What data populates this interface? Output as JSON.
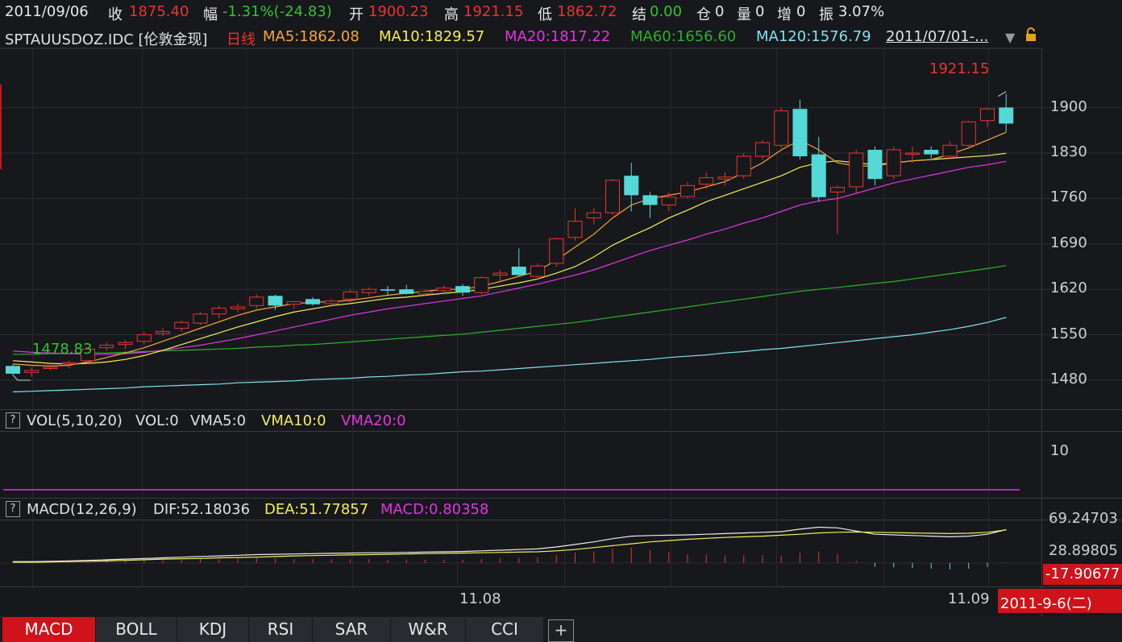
{
  "header": {
    "date": "2011/09/06",
    "close_label": "收",
    "close_value": "1875.40",
    "change_label": "幅",
    "change_value": "-1.31%(-24.83)",
    "open_label": "开",
    "open_value": "1900.23",
    "high_label": "高",
    "high_value": "1921.15",
    "low_label": "低",
    "low_value": "1862.72",
    "settle_label": "结",
    "settle_value": "0.00",
    "position_label": "仓",
    "position_value": "0",
    "volume_label": "量",
    "volume_value": "0",
    "increase_label": "增",
    "increase_value": "0",
    "amplitude_label": "振",
    "amplitude_value": "3.07%"
  },
  "main_panel": {
    "symbol": "SPTAUUSDOZ.IDC [伦敦金现]",
    "period": "日线",
    "ma5": "MA5:1862.08",
    "ma10": "MA10:1829.57",
    "ma20": "MA20:1817.22",
    "ma60": "MA60:1656.60",
    "ma120": "MA120:1576.79",
    "range": "2011/07/01-...",
    "high_marker": "1921.15",
    "low_marker": "1478.83",
    "y_ticks": [
      "1900",
      "1830",
      "1760",
      "1690",
      "1620",
      "1550",
      "1480"
    ]
  },
  "vol_panel": {
    "q": "?",
    "name": "VOL(5,10,20)",
    "vol": "VOL:0",
    "vma5": "VMA5:0",
    "vma10": "VMA10:0",
    "vma20": "VMA20:0",
    "y_tick": "10"
  },
  "macd_panel": {
    "q": "?",
    "name": "MACD(12,26,9)",
    "dif": "DIF:52.18036",
    "dea": "DEA:51.77857",
    "macd": "MACD:0.80358",
    "y_ticks": [
      "69.24703",
      "28.89805",
      "-17.90677"
    ]
  },
  "x_axis": {
    "labels": [
      "11.08",
      "11.09"
    ],
    "current_date": "2011-9-6(二)"
  },
  "tabs": [
    "MACD",
    "BOLL",
    "KDJ",
    "RSI",
    "SAR",
    "W&R",
    "CCI",
    "+"
  ],
  "colors": {
    "up": "#e8352f",
    "down": "#54d8d8",
    "ma5": "#f6a53a",
    "ma10": "#f2ef57",
    "ma20": "#e035e0",
    "ma60": "#2ab12a",
    "ma120": "#7de3ee"
  },
  "chart_data": {
    "type": "candlestick",
    "price_range": [
      1450,
      1930
    ],
    "candles": [
      {
        "o": 1502,
        "h": 1505,
        "l": 1488,
        "c": 1490
      },
      {
        "o": 1492,
        "h": 1500,
        "l": 1485,
        "c": 1495
      },
      {
        "o": 1498,
        "h": 1505,
        "l": 1495,
        "c": 1500
      },
      {
        "o": 1505,
        "h": 1510,
        "l": 1498,
        "c": 1507
      },
      {
        "o": 1510,
        "h": 1530,
        "l": 1505,
        "c": 1528
      },
      {
        "o": 1530,
        "h": 1538,
        "l": 1525,
        "c": 1534
      },
      {
        "o": 1535,
        "h": 1542,
        "l": 1528,
        "c": 1538
      },
      {
        "o": 1540,
        "h": 1555,
        "l": 1535,
        "c": 1550
      },
      {
        "o": 1552,
        "h": 1560,
        "l": 1548,
        "c": 1555
      },
      {
        "o": 1560,
        "h": 1572,
        "l": 1555,
        "c": 1569
      },
      {
        "o": 1568,
        "h": 1585,
        "l": 1565,
        "c": 1582
      },
      {
        "o": 1582,
        "h": 1595,
        "l": 1575,
        "c": 1591
      },
      {
        "o": 1590,
        "h": 1598,
        "l": 1585,
        "c": 1593
      },
      {
        "o": 1595,
        "h": 1612,
        "l": 1590,
        "c": 1608
      },
      {
        "o": 1610,
        "h": 1612,
        "l": 1588,
        "c": 1595
      },
      {
        "o": 1597,
        "h": 1602,
        "l": 1590,
        "c": 1601
      },
      {
        "o": 1605,
        "h": 1608,
        "l": 1595,
        "c": 1597
      },
      {
        "o": 1598,
        "h": 1605,
        "l": 1596,
        "c": 1602
      },
      {
        "o": 1605,
        "h": 1620,
        "l": 1600,
        "c": 1616
      },
      {
        "o": 1615,
        "h": 1623,
        "l": 1610,
        "c": 1620
      },
      {
        "o": 1620,
        "h": 1625,
        "l": 1610,
        "c": 1618
      },
      {
        "o": 1620,
        "h": 1627,
        "l": 1612,
        "c": 1613
      },
      {
        "o": 1613,
        "h": 1620,
        "l": 1610,
        "c": 1617
      },
      {
        "o": 1618,
        "h": 1626,
        "l": 1612,
        "c": 1622
      },
      {
        "o": 1625,
        "h": 1628,
        "l": 1610,
        "c": 1615
      },
      {
        "o": 1615,
        "h": 1640,
        "l": 1612,
        "c": 1638
      },
      {
        "o": 1642,
        "h": 1650,
        "l": 1632,
        "c": 1645
      },
      {
        "o": 1655,
        "h": 1683,
        "l": 1640,
        "c": 1642
      },
      {
        "o": 1640,
        "h": 1660,
        "l": 1635,
        "c": 1656
      },
      {
        "o": 1660,
        "h": 1700,
        "l": 1655,
        "c": 1698
      },
      {
        "o": 1700,
        "h": 1745,
        "l": 1695,
        "c": 1725
      },
      {
        "o": 1730,
        "h": 1745,
        "l": 1720,
        "c": 1738
      },
      {
        "o": 1738,
        "h": 1790,
        "l": 1735,
        "c": 1788
      },
      {
        "o": 1795,
        "h": 1815,
        "l": 1740,
        "c": 1765
      },
      {
        "o": 1765,
        "h": 1770,
        "l": 1730,
        "c": 1750
      },
      {
        "o": 1750,
        "h": 1770,
        "l": 1740,
        "c": 1762
      },
      {
        "o": 1763,
        "h": 1785,
        "l": 1760,
        "c": 1780
      },
      {
        "o": 1782,
        "h": 1800,
        "l": 1775,
        "c": 1792
      },
      {
        "o": 1790,
        "h": 1800,
        "l": 1780,
        "c": 1793
      },
      {
        "o": 1795,
        "h": 1830,
        "l": 1790,
        "c": 1825
      },
      {
        "o": 1825,
        "h": 1850,
        "l": 1820,
        "c": 1846
      },
      {
        "o": 1842,
        "h": 1900,
        "l": 1838,
        "c": 1895
      },
      {
        "o": 1898,
        "h": 1912,
        "l": 1820,
        "c": 1825
      },
      {
        "o": 1828,
        "h": 1855,
        "l": 1755,
        "c": 1762
      },
      {
        "o": 1770,
        "h": 1780,
        "l": 1705,
        "c": 1777
      },
      {
        "o": 1778,
        "h": 1835,
        "l": 1768,
        "c": 1830
      },
      {
        "o": 1835,
        "h": 1840,
        "l": 1780,
        "c": 1790
      },
      {
        "o": 1795,
        "h": 1840,
        "l": 1790,
        "c": 1835
      },
      {
        "o": 1830,
        "h": 1840,
        "l": 1815,
        "c": 1830
      },
      {
        "o": 1835,
        "h": 1840,
        "l": 1822,
        "c": 1828
      },
      {
        "o": 1825,
        "h": 1848,
        "l": 1820,
        "c": 1842
      },
      {
        "o": 1842,
        "h": 1880,
        "l": 1838,
        "c": 1878
      },
      {
        "o": 1880,
        "h": 1900,
        "l": 1870,
        "c": 1898
      },
      {
        "o": 1900.23,
        "h": 1921.15,
        "l": 1862.72,
        "c": 1875.4
      }
    ],
    "ma5": [
      1505,
      1503,
      1502,
      1503,
      1508,
      1515,
      1522,
      1530,
      1540,
      1550,
      1560,
      1570,
      1580,
      1588,
      1593,
      1598,
      1600,
      1601,
      1603,
      1607,
      1611,
      1614,
      1617,
      1620,
      1620,
      1625,
      1632,
      1640,
      1648,
      1665,
      1685,
      1705,
      1730,
      1750,
      1760,
      1765,
      1770,
      1778,
      1786,
      1800,
      1815,
      1835,
      1850,
      1835,
      1815,
      1810,
      1810,
      1815,
      1818,
      1820,
      1828,
      1838,
      1850,
      1862.08
    ],
    "ma10": [
      1510,
      1508,
      1506,
      1505,
      1506,
      1508,
      1512,
      1518,
      1526,
      1535,
      1544,
      1553,
      1562,
      1570,
      1578,
      1585,
      1590,
      1595,
      1598,
      1602,
      1606,
      1608,
      1611,
      1614,
      1616,
      1620,
      1625,
      1630,
      1636,
      1645,
      1655,
      1670,
      1688,
      1702,
      1715,
      1730,
      1742,
      1755,
      1765,
      1775,
      1785,
      1795,
      1808,
      1815,
      1818,
      1815,
      1812,
      1815,
      1818,
      1820,
      1822,
      1824,
      1826,
      1829.57
    ],
    "ma20": [
      1525,
      1523,
      1522,
      1521,
      1520,
      1520,
      1521,
      1523,
      1526,
      1530,
      1534,
      1539,
      1544,
      1550,
      1556,
      1562,
      1568,
      1574,
      1580,
      1585,
      1590,
      1594,
      1598,
      1602,
      1606,
      1610,
      1616,
      1622,
      1628,
      1635,
      1642,
      1650,
      1660,
      1670,
      1680,
      1688,
      1696,
      1705,
      1713,
      1722,
      1730,
      1740,
      1750,
      1756,
      1760,
      1768,
      1776,
      1784,
      1790,
      1796,
      1802,
      1808,
      1812,
      1817.22
    ],
    "ma60": [
      1520,
      1520,
      1521,
      1521,
      1522,
      1522,
      1523,
      1524,
      1525,
      1526,
      1527,
      1528,
      1529,
      1531,
      1532,
      1534,
      1535,
      1537,
      1539,
      1541,
      1543,
      1545,
      1547,
      1549,
      1551,
      1554,
      1557,
      1560,
      1563,
      1566,
      1569,
      1573,
      1577,
      1581,
      1585,
      1589,
      1593,
      1597,
      1601,
      1605,
      1609,
      1613,
      1617,
      1620,
      1623,
      1626,
      1629,
      1632,
      1636,
      1640,
      1644,
      1648,
      1652,
      1656.6
    ],
    "ma120": [
      1462,
      1463,
      1464,
      1465,
      1466,
      1467,
      1468,
      1470,
      1471,
      1472,
      1473,
      1474,
      1476,
      1477,
      1478,
      1479,
      1481,
      1482,
      1483,
      1485,
      1486,
      1488,
      1489,
      1491,
      1493,
      1494,
      1496,
      1498,
      1500,
      1502,
      1504,
      1506,
      1508,
      1510,
      1512,
      1515,
      1517,
      1519,
      1522,
      1524,
      1527,
      1529,
      1532,
      1535,
      1538,
      1541,
      1544,
      1547,
      1550,
      1554,
      1558,
      1563,
      1569,
      1576.79
    ],
    "macd_range": [
      -17.90677,
      69.24703
    ],
    "dif": [
      2,
      2,
      2.5,
      3,
      4,
      5,
      6,
      7,
      8,
      9,
      10,
      11,
      12,
      13,
      13.5,
      14,
      14.5,
      15,
      15.5,
      16,
      16,
      16.5,
      17,
      17.5,
      18,
      19,
      20,
      21,
      22,
      25,
      29,
      33,
      38,
      42,
      43,
      43.5,
      44,
      45,
      46,
      47,
      48,
      49,
      53,
      56,
      55,
      50,
      45,
      44,
      43,
      42,
      41,
      42,
      45,
      52.18036
    ],
    "dea": [
      1,
      1,
      1.5,
      2,
      2.5,
      3,
      4,
      5,
      6,
      6.5,
      7,
      8,
      8.5,
      9,
      10,
      11,
      11.5,
      12,
      12.5,
      13,
      13.5,
      14,
      14.5,
      15,
      15.5,
      16,
      16.5,
      17,
      17.5,
      19,
      21,
      24,
      27,
      30,
      33,
      35,
      37,
      38.5,
      40,
      41,
      42,
      43.5,
      45,
      47,
      48,
      48.5,
      48,
      47.5,
      47,
      46.5,
      46,
      46.5,
      48,
      51.77857
    ],
    "macd_hist_scale": 2
  }
}
